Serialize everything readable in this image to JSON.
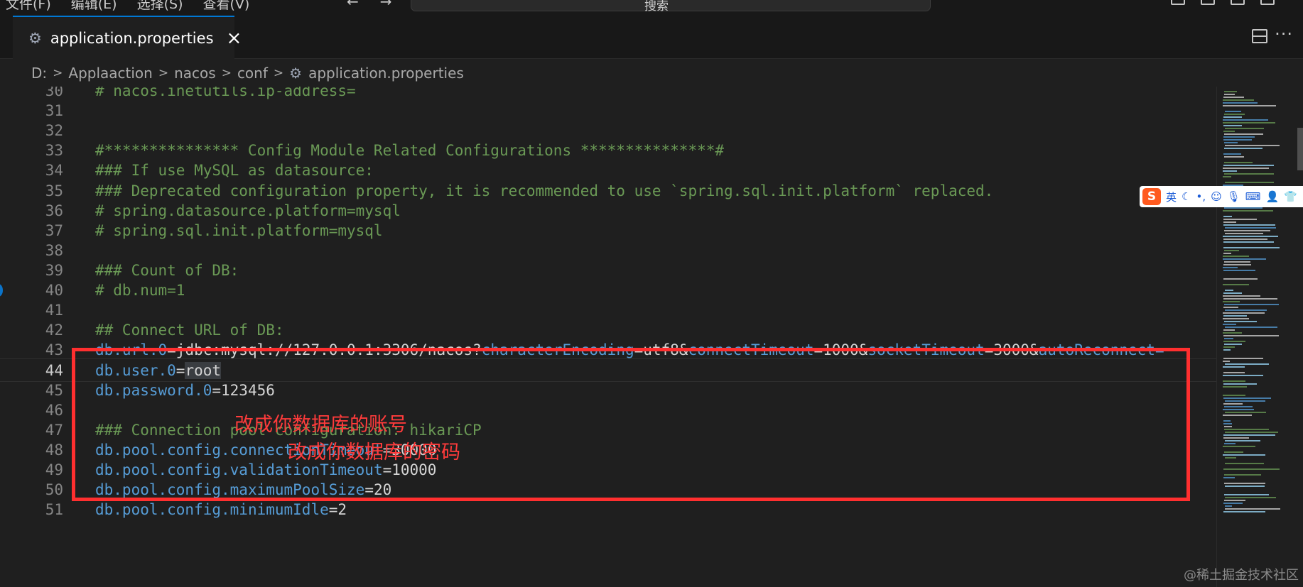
{
  "titlebar": {
    "menus": [
      "文件(F)",
      "编辑(E)",
      "选择(S)",
      "查看(V)"
    ],
    "back_arrow": "←",
    "forward_arrow": "→",
    "search_text": "搜索"
  },
  "tab": {
    "icon": "gear-icon",
    "label": "application.properties",
    "close": "×"
  },
  "tab_actions": {
    "split_icon": "split-editor-icon",
    "more": "···"
  },
  "breadcrumb": {
    "items": [
      "D:",
      "Applaaction",
      "nacos",
      "conf",
      "application.properties"
    ],
    "separator": ">"
  },
  "editor": {
    "current_line": 44,
    "lines": [
      {
        "num": "30",
        "tokens": [
          {
            "t": "# nacos.inetutils.ip-address=",
            "c": "comment"
          }
        ]
      },
      {
        "num": "31",
        "tokens": []
      },
      {
        "num": "32",
        "tokens": []
      },
      {
        "num": "33",
        "tokens": [
          {
            "t": "#*************** Config Module Related Configurations ***************#",
            "c": "comment"
          }
        ]
      },
      {
        "num": "34",
        "tokens": [
          {
            "t": "### If use MySQL as datasource:",
            "c": "comment"
          }
        ]
      },
      {
        "num": "35",
        "tokens": [
          {
            "t": "### Deprecated configuration property, it is recommended to use `spring.sql.init.platform` replaced.",
            "c": "comment"
          }
        ]
      },
      {
        "num": "36",
        "tokens": [
          {
            "t": "# spring.datasource.platform=mysql",
            "c": "comment"
          }
        ]
      },
      {
        "num": "37",
        "tokens": [
          {
            "t": "# spring.sql.init.platform=mysql",
            "c": "comment"
          }
        ]
      },
      {
        "num": "38",
        "tokens": []
      },
      {
        "num": "39",
        "tokens": [
          {
            "t": "### Count of DB:",
            "c": "comment"
          }
        ]
      },
      {
        "num": "40",
        "tokens": [
          {
            "t": "# db.num=1",
            "c": "comment"
          }
        ]
      },
      {
        "num": "41",
        "tokens": []
      },
      {
        "num": "42",
        "tokens": [
          {
            "t": "## Connect URL of DB:",
            "c": "comment"
          }
        ]
      },
      {
        "num": "43",
        "tokens": [
          {
            "t": "db.url.0",
            "c": "key2"
          },
          {
            "t": "=jdbc:mysql://127.0.0.1:3306/nacos?",
            "c": "plain"
          },
          {
            "t": "characterEncoding",
            "c": "key2"
          },
          {
            "t": "=utf8&",
            "c": "plain"
          },
          {
            "t": "connectTimeout",
            "c": "key2"
          },
          {
            "t": "=1000&",
            "c": "plain"
          },
          {
            "t": "socketTimeout",
            "c": "key2"
          },
          {
            "t": "=3000&",
            "c": "plain"
          },
          {
            "t": "autoReconnect=",
            "c": "key2"
          }
        ]
      },
      {
        "num": "44",
        "tokens": [
          {
            "t": "db.user.0",
            "c": "key2"
          },
          {
            "t": "=",
            "c": "plain"
          },
          {
            "t": "root",
            "c": "sel"
          }
        ]
      },
      {
        "num": "45",
        "tokens": [
          {
            "t": "db.password.0",
            "c": "key2"
          },
          {
            "t": "=123456",
            "c": "plain"
          }
        ]
      },
      {
        "num": "46",
        "tokens": []
      },
      {
        "num": "47",
        "tokens": [
          {
            "t": "### Connection pool configuration: hikariCP",
            "c": "comment"
          }
        ]
      },
      {
        "num": "48",
        "tokens": [
          {
            "t": "db.pool.config.",
            "c": "key2"
          },
          {
            "t": "connectionTimeout",
            "c": "key2"
          },
          {
            "t": "=30000",
            "c": "plain"
          }
        ]
      },
      {
        "num": "49",
        "tokens": [
          {
            "t": "db.pool.config.",
            "c": "key2"
          },
          {
            "t": "validationTimeout",
            "c": "key2"
          },
          {
            "t": "=10000",
            "c": "plain"
          }
        ]
      },
      {
        "num": "50",
        "tokens": [
          {
            "t": "db.pool.config.",
            "c": "key2"
          },
          {
            "t": "maximumPoolSize",
            "c": "key2"
          },
          {
            "t": "=20",
            "c": "plain"
          }
        ]
      },
      {
        "num": "51",
        "tokens": [
          {
            "t": "db.pool.config.",
            "c": "key2"
          },
          {
            "t": "minimumIdle",
            "c": "key2"
          },
          {
            "t": "=2",
            "c": "plain"
          }
        ]
      }
    ]
  },
  "annotations": {
    "user_note": "改成你数据库的账号",
    "password_note": "改成你数据库的密码"
  },
  "ime_toolbar": {
    "logo": "S",
    "lang": "英",
    "items": [
      "moon-icon",
      "punctuation-icon",
      "emoji-icon",
      "microphone-icon",
      "keyboard-icon",
      "user-icon",
      "skin-icon"
    ]
  },
  "watermark": "@稀土掘金技术社区",
  "colors": {
    "background": "#1f1f1f",
    "comment": "#6a9955",
    "key": "#569cd6",
    "annotation_red": "#ff2f2f",
    "accent": "#0078d4"
  }
}
